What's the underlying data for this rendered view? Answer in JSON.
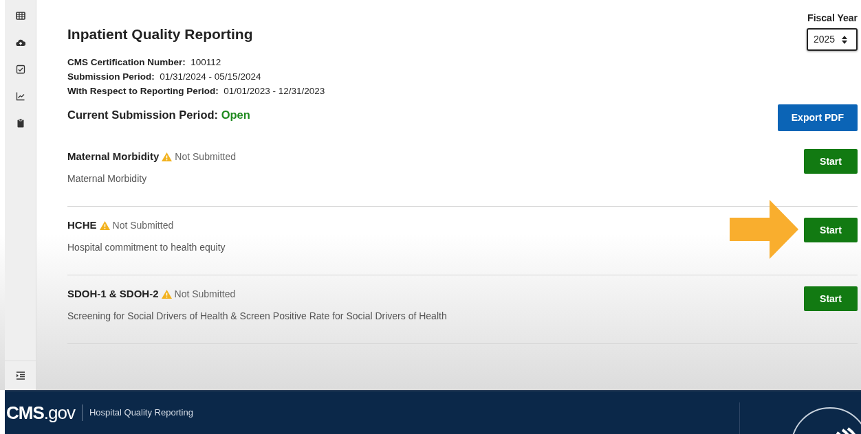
{
  "sidebar": {
    "items": [
      {
        "kind": "table"
      },
      {
        "kind": "upload"
      },
      {
        "kind": "checkbox"
      },
      {
        "kind": "chart"
      },
      {
        "kind": "clipboard"
      }
    ],
    "toggle": {
      "kind": "collapse"
    }
  },
  "page": {
    "title": "Inpatient Quality Reporting",
    "details": [
      {
        "label": "CMS Certification Number:",
        "value": "100112"
      },
      {
        "label": "Submission Period:",
        "value": "01/31/2024 - 05/15/2024"
      },
      {
        "label": "With Respect to Reporting Period:",
        "value": "01/01/2023 - 12/31/2023"
      }
    ],
    "current_period": {
      "label": "Current Submission Period:",
      "value": "Open"
    }
  },
  "fiscal_year": {
    "label": "Fiscal Year",
    "value": "2025"
  },
  "export_button": "Export PDF",
  "measures": [
    {
      "name": "Maternal Morbidity",
      "status": "Not Submitted",
      "description": "Maternal Morbidity",
      "button": "Start",
      "highlighted": false
    },
    {
      "name": "HCHE",
      "status": "Not Submitted",
      "description": "Hospital commitment to health equity",
      "button": "Start",
      "highlighted": true
    },
    {
      "name": "SDOH-1 & SDOH-2",
      "status": "Not Submitted",
      "description": "Screening for Social Drivers of Health & Screen Positive Rate for Social Drivers of Health",
      "button": "Start",
      "highlighted": false
    }
  ],
  "footer": {
    "brand": "CMS",
    "brand_suffix": ".gov",
    "site": "Hospital Quality Reporting"
  }
}
